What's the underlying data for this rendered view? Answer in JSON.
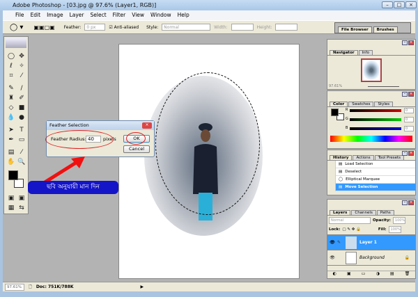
{
  "window": {
    "title": "Adobe Photoshop - [03.jpg @ 97.6% (Layer1, RGB)]"
  },
  "menu": [
    "File",
    "Edit",
    "Image",
    "Layer",
    "Select",
    "Filter",
    "View",
    "Window",
    "Help"
  ],
  "options": {
    "feather_label": "Feather:",
    "feather_value": "0 px",
    "antialiased": "Anti-aliased",
    "style_label": "Style:",
    "style_value": "Normal",
    "width_label": "Width:",
    "height_label": "Height:"
  },
  "palette_well": {
    "tabs": [
      "File Browser",
      "Brushes"
    ]
  },
  "dialog": {
    "title": "Feather Selection",
    "radius_label": "Feather Radius:",
    "radius_value": "40",
    "unit": "pixels",
    "ok": "OK",
    "cancel": "Cancel"
  },
  "annotation": {
    "text": "ছবি অনুযায়ী মান দিন",
    "color": "#1414c8"
  },
  "navigator": {
    "tabs": [
      "Navigator",
      "Info"
    ],
    "zoom": "97.61%"
  },
  "color_panel": {
    "tabs": [
      "Color",
      "Swatches",
      "Styles"
    ],
    "channels": [
      {
        "name": "R",
        "value": "0"
      },
      {
        "name": "G",
        "value": "0"
      },
      {
        "name": "B",
        "value": "0"
      }
    ]
  },
  "history": {
    "tabs": [
      "History",
      "Actions",
      "Tool Presets"
    ],
    "items": [
      "Load Selection",
      "Deselect",
      "Elliptical Marquee",
      "Move Selection"
    ]
  },
  "layers": {
    "tabs": [
      "Layers",
      "Channels",
      "Paths"
    ],
    "blend": "Normal",
    "opacity_label": "Opacity:",
    "opacity": "100%",
    "lock_label": "Lock:",
    "fill_label": "Fill:",
    "fill": "100%",
    "items": [
      "Layer 1",
      "Background"
    ]
  },
  "status": {
    "zoom": "97.61%",
    "doc": "Doc: 751K/788K"
  }
}
